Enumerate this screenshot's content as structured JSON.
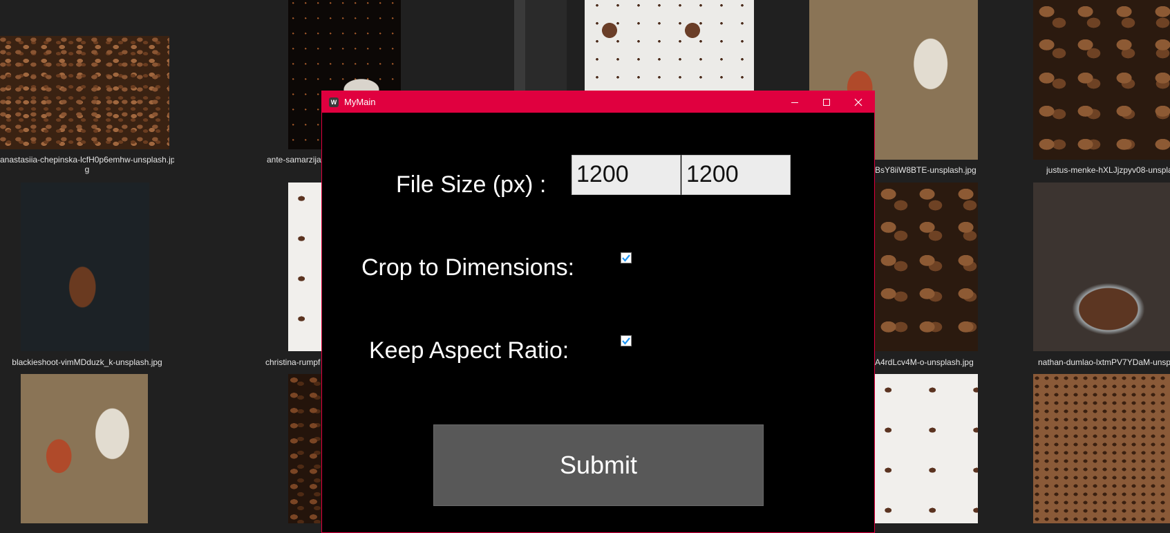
{
  "window": {
    "title": "MyMain",
    "accent_color": "#e0003f",
    "minimize_icon": "minimize-icon",
    "maximize_icon": "maximize-icon",
    "close_icon": "close-icon"
  },
  "form": {
    "file_size_label": "File Size (px) :",
    "width_value": "1200",
    "height_value": "1200",
    "crop_label": "Crop to Dimensions:",
    "crop_checked": true,
    "aspect_label": "Keep Aspect Ratio:",
    "aspect_checked": true,
    "submit_label": "Submit"
  },
  "background_files": [
    {
      "label_line1": "anastasiia-chepinska-lcfH0p6emhw-unsplash.jp",
      "label_line2": "g"
    },
    {
      "label": "ante-samarzija"
    },
    {
      "label": "BsY8iiW8BTE-unsplash.jpg"
    },
    {
      "label": "justus-menke-hXLJjzpyv08-unspla"
    },
    {
      "label": "blackieshoot-vimMDduzk_k-unsplash.jpg"
    },
    {
      "label": "christina-rumpf"
    },
    {
      "label": "A4rdLcv4M-o-unsplash.jpg"
    },
    {
      "label": "nathan-dumlao-lxtmPV7YDaM-unsp"
    }
  ]
}
